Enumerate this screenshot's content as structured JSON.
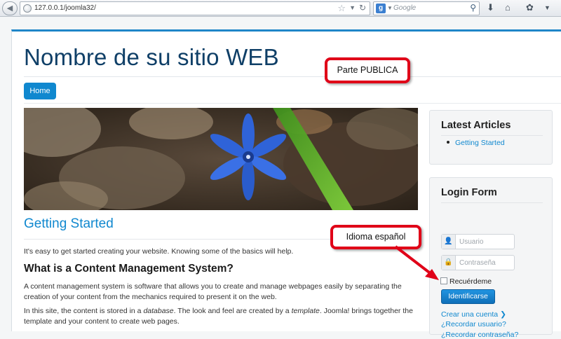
{
  "browser": {
    "url": "127.0.0.1/joomla32/",
    "search_engine": "g",
    "search_placeholder": "Google",
    "accent": "#1088cf"
  },
  "site": {
    "title": "Nombre de su sitio WEB",
    "menu": {
      "home_label": "Home"
    }
  },
  "article": {
    "title": "Getting Started",
    "intro": "It's easy to get started creating your website. Knowing some of the basics will help.",
    "heading": "What is a Content Management System?",
    "para1": "A content management system is software that allows you to create and manage webpages easily by separating the creation of your content from the mechanics required to present it on the web.",
    "para2_a": "In this site, the content is stored in a ",
    "para2_em1": "database",
    "para2_b": ". The look and feel are created by a ",
    "para2_em2": "template",
    "para2_c": ". Joomla! brings together the template and your content to create web pages."
  },
  "sidebar": {
    "latest": {
      "title": "Latest Articles",
      "items": [
        {
          "label": "Getting Started"
        }
      ]
    },
    "login": {
      "title": "Login Form",
      "username_placeholder": "Usuario",
      "password_placeholder": "Contraseña",
      "remember_label": "Recuérdeme",
      "submit_label": "Identificarse",
      "links": [
        {
          "label": "Crear una cuenta",
          "icon": "chevron-right-icon"
        },
        {
          "label": "¿Recordar usuario?"
        },
        {
          "label": "¿Recordar contraseña?"
        }
      ]
    }
  },
  "annotations": {
    "public_label": "Parte PUBLICA",
    "language_label": "Idioma español",
    "color": "#e00018"
  }
}
